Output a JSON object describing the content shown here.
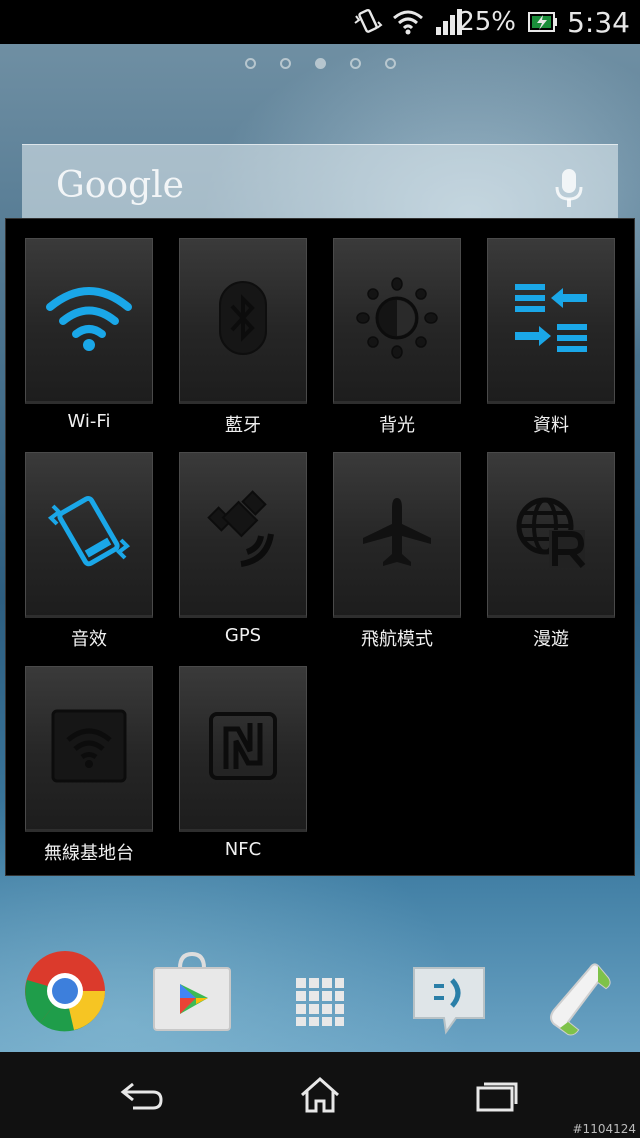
{
  "status_bar": {
    "battery_percent": "25%",
    "time": "5:34",
    "icons": [
      "vibrate-icon",
      "wifi-icon",
      "signal-icon",
      "battery-charging-icon"
    ]
  },
  "home": {
    "page_count": 5,
    "active_page": 3,
    "search_logo": "Google"
  },
  "quick_settings": {
    "tiles": [
      {
        "label": "Wi-Fi",
        "icon": "wifi-icon",
        "active": true
      },
      {
        "label": "藍牙",
        "icon": "bluetooth-icon",
        "active": false
      },
      {
        "label": "背光",
        "icon": "brightness-icon",
        "active": false
      },
      {
        "label": "資料",
        "icon": "data-transfer-icon",
        "active": true
      },
      {
        "label": "音效",
        "icon": "vibrate-phone-icon",
        "active": true
      },
      {
        "label": "GPS",
        "icon": "gps-satellite-icon",
        "active": false
      },
      {
        "label": "飛航模式",
        "icon": "airplane-icon",
        "active": false
      },
      {
        "label": "漫遊",
        "icon": "roaming-globe-icon",
        "active": false
      },
      {
        "label": "無線基地台",
        "icon": "hotspot-icon",
        "active": false
      },
      {
        "label": "NFC",
        "icon": "nfc-icon",
        "active": false
      }
    ],
    "active_color": "#1aa7e8",
    "inactive_color": "#141414"
  },
  "dock": {
    "apps": [
      "chrome-icon",
      "play-store-icon",
      "app-drawer-icon",
      "messaging-icon",
      "phone-icon"
    ]
  },
  "nav_bar": {
    "buttons": [
      "back-icon",
      "home-icon",
      "recents-icon"
    ]
  },
  "watermark": "#1104124"
}
